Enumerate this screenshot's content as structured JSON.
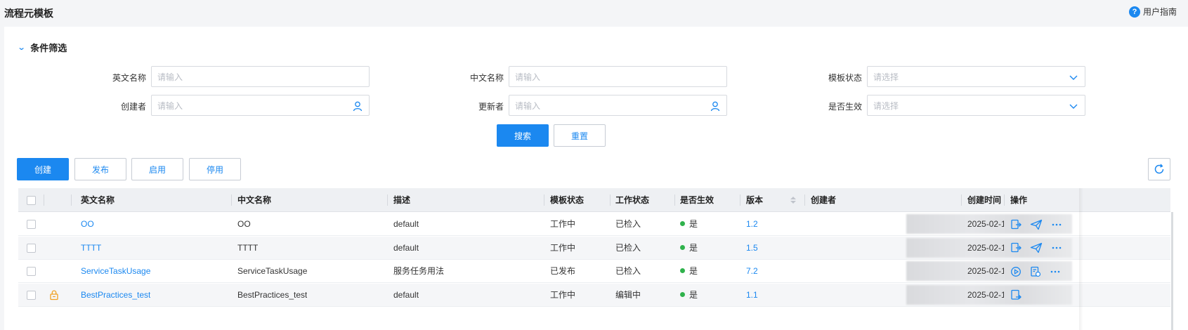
{
  "page": {
    "title": "流程元模板",
    "guide_label": "用户指南"
  },
  "filter": {
    "section_title": "条件筛选",
    "fields": {
      "en_name": {
        "label": "英文名称",
        "placeholder": "请输入"
      },
      "cn_name": {
        "label": "中文名称",
        "placeholder": "请输入"
      },
      "template_status": {
        "label": "模板状态",
        "placeholder": "请选择"
      },
      "creator": {
        "label": "创建者",
        "placeholder": "请输入"
      },
      "updater": {
        "label": "更新者",
        "placeholder": "请输入"
      },
      "effective": {
        "label": "是否生效",
        "placeholder": "请选择"
      }
    },
    "search_label": "搜索",
    "reset_label": "重置"
  },
  "toolbar": {
    "create_label": "创建",
    "publish_label": "发布",
    "enable_label": "启用",
    "disable_label": "停用"
  },
  "table": {
    "columns": {
      "en_name": "英文名称",
      "cn_name": "中文名称",
      "desc": "描述",
      "template_status": "模板状态",
      "work_status": "工作状态",
      "effective": "是否生效",
      "version": "版本",
      "creator": "创建者",
      "created_time": "创建时间",
      "actions": "操作"
    },
    "rows": [
      {
        "en_name": "OO",
        "cn_name": "OO",
        "desc": "default",
        "template_status": "工作中",
        "work_status": "已检入",
        "effective": "是",
        "version": "1.2",
        "created_time": "2025-02-1",
        "locked": false,
        "actions": [
          "edit-publish-icon",
          "send-icon",
          "more-icon"
        ]
      },
      {
        "en_name": "TTTT",
        "cn_name": "TTTT",
        "desc": "default",
        "template_status": "工作中",
        "work_status": "已检入",
        "effective": "是",
        "version": "1.5",
        "created_time": "2025-02-1",
        "locked": false,
        "actions": [
          "edit-publish-icon",
          "send-icon",
          "more-icon"
        ]
      },
      {
        "en_name": "ServiceTaskUsage",
        "cn_name": "ServiceTaskUsage",
        "desc": "服务任务用法",
        "template_status": "已发布",
        "work_status": "已检入",
        "effective": "是",
        "version": "7.2",
        "created_time": "2025-02-1",
        "locked": false,
        "actions": [
          "play-icon",
          "document-refresh-icon",
          "more-icon"
        ]
      },
      {
        "en_name": "BestPractices_test",
        "cn_name": "BestPractices_test",
        "desc": "default",
        "template_status": "工作中",
        "work_status": "编辑中",
        "effective": "是",
        "version": "1.1",
        "created_time": "2025-02-1",
        "locked": true,
        "actions": [
          "checkin-icon"
        ]
      }
    ]
  },
  "colors": {
    "primary": "#1b88f0",
    "success_dot": "#2fb24c"
  }
}
